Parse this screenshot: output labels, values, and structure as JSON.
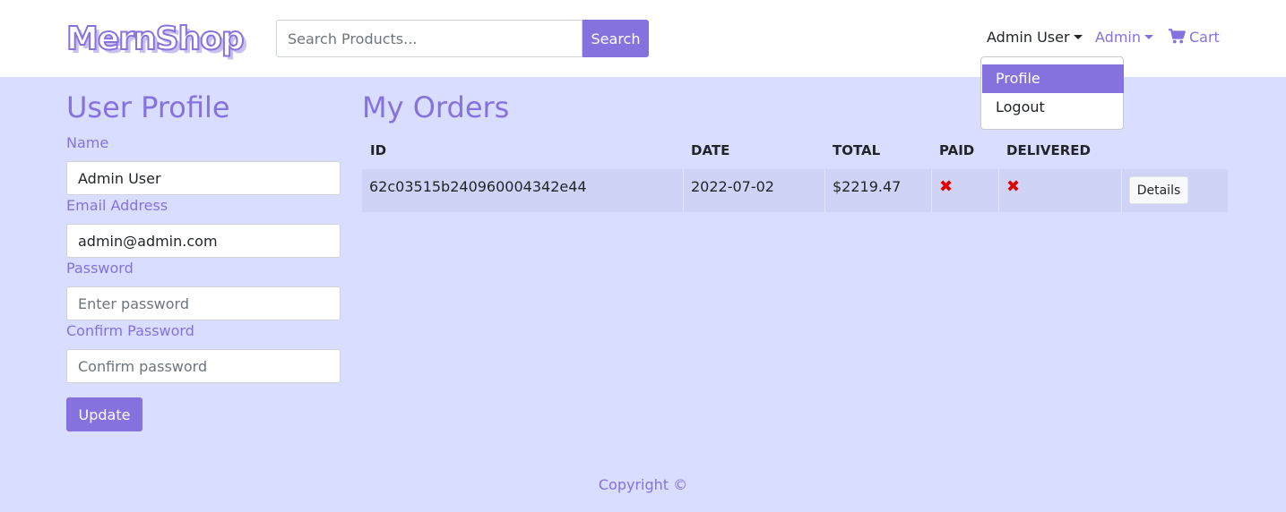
{
  "brand": {
    "name": "MernShop"
  },
  "search": {
    "placeholder": "Search Products...",
    "value": "",
    "button_label": "Search"
  },
  "nav": {
    "user_label": "Admin User",
    "admin_label": "Admin",
    "cart_label": "Cart",
    "cart_icon": "shopping-cart-icon",
    "user_dropdown": {
      "open": true,
      "items": [
        "Profile",
        "Logout"
      ],
      "active_item": "Profile"
    }
  },
  "profile": {
    "title": "User Profile",
    "name_label": "Name",
    "name_value": "Admin User",
    "email_label": "Email Address",
    "email_value": "admin@admin.com",
    "password_label": "Password",
    "password_placeholder": "Enter password",
    "confirm_label": "Confirm Password",
    "confirm_placeholder": "Confirm password",
    "update_label": "Update"
  },
  "orders": {
    "title": "My Orders",
    "columns": [
      "ID",
      "DATE",
      "TOTAL",
      "PAID",
      "DELIVERED",
      ""
    ],
    "rows": [
      {
        "id": "62c03515b240960004342e44",
        "date": "2022-07-02",
        "total": "$2219.47",
        "paid": false,
        "delivered": false,
        "action_label": "Details"
      }
    ],
    "status_icon": "x-mark-icon"
  },
  "footer": {
    "text": "Copyright ©"
  },
  "colors": {
    "accent": "#8572df",
    "background": "#d9ddff",
    "row": "#cfd4f7",
    "error": "#e00000"
  }
}
